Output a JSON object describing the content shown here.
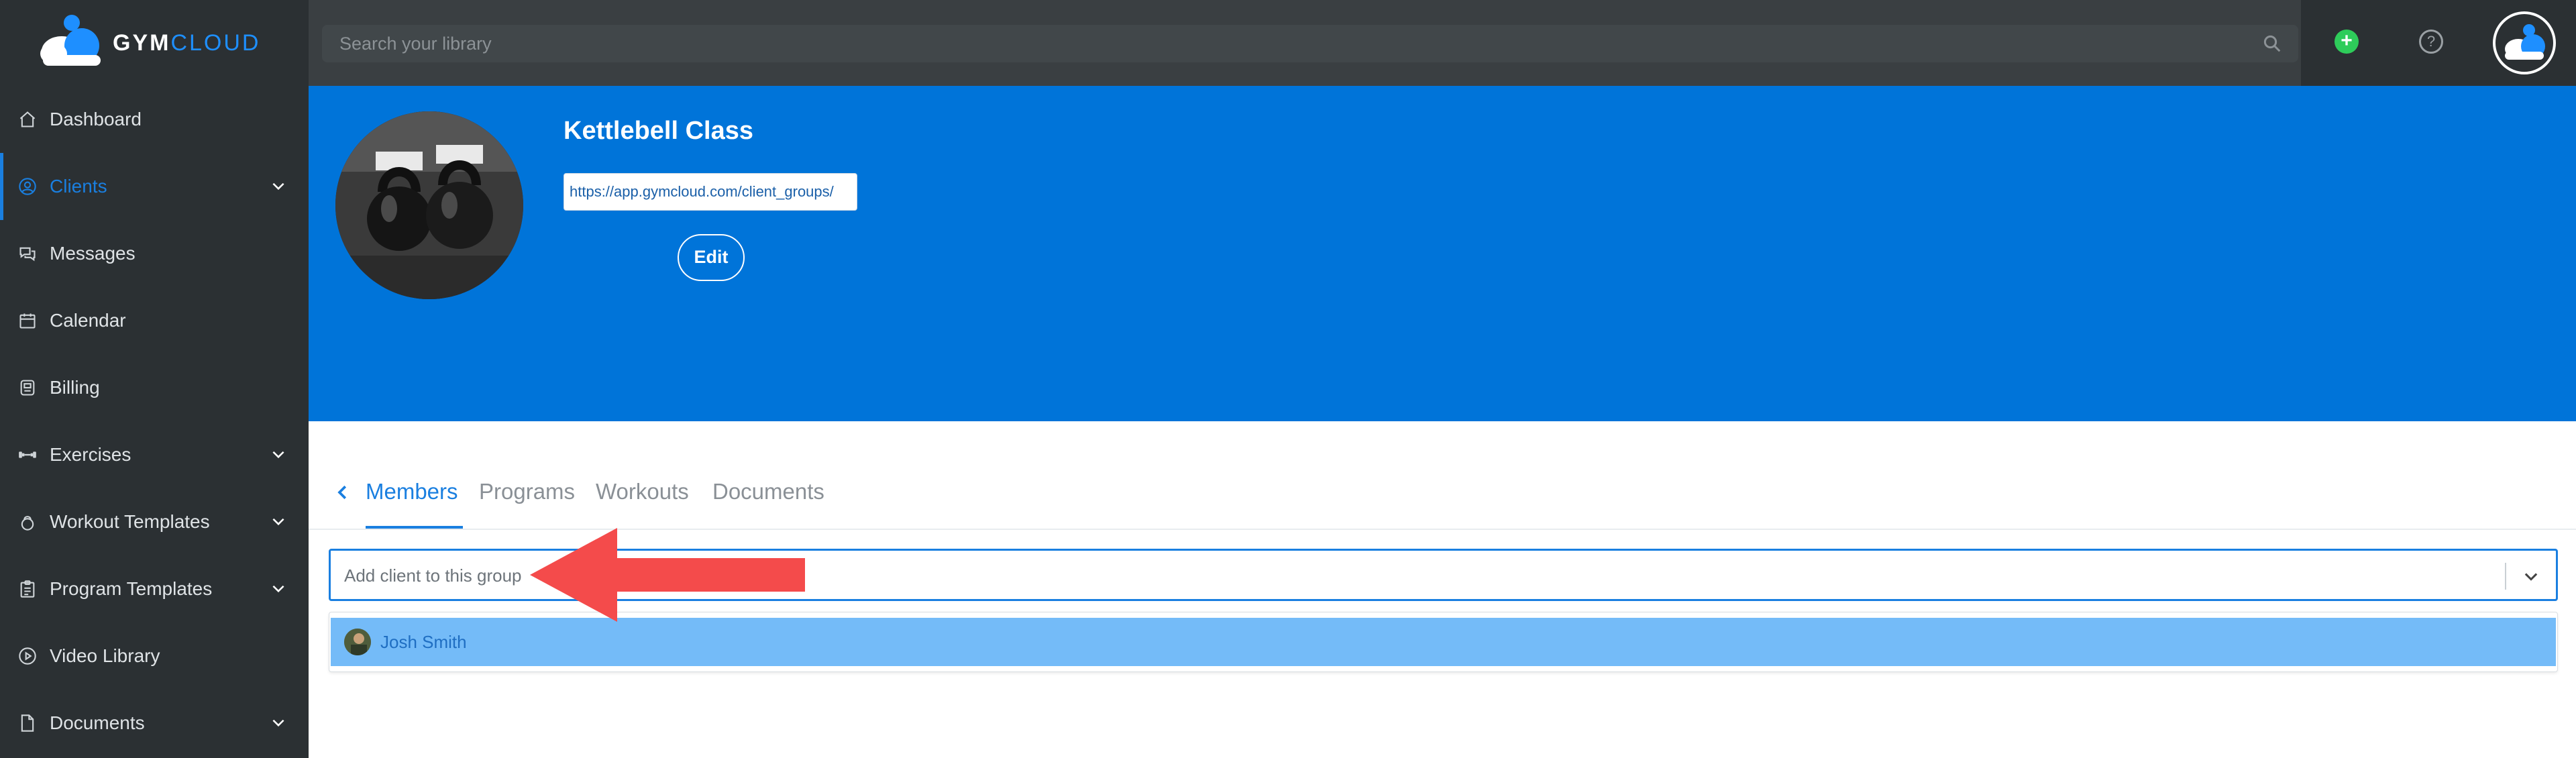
{
  "brand": {
    "name_white": "GYM",
    "name_blue": "CLOUD"
  },
  "search": {
    "placeholder": "Search your library"
  },
  "sidebar": {
    "items": [
      {
        "label": "Dashboard",
        "icon": "home-icon",
        "has_chevron": false,
        "active": false
      },
      {
        "label": "Clients",
        "icon": "user-circle-icon",
        "has_chevron": true,
        "active": true
      },
      {
        "label": "Messages",
        "icon": "chat-icon",
        "has_chevron": false,
        "active": false
      },
      {
        "label": "Calendar",
        "icon": "calendar-icon",
        "has_chevron": false,
        "active": false
      },
      {
        "label": "Billing",
        "icon": "billing-icon",
        "has_chevron": false,
        "active": false
      },
      {
        "label": "Exercises",
        "icon": "dumbbell-icon",
        "has_chevron": true,
        "active": false
      },
      {
        "label": "Workout Templates",
        "icon": "kettlebell-icon",
        "has_chevron": true,
        "active": false
      },
      {
        "label": "Program Templates",
        "icon": "clipboard-icon",
        "has_chevron": true,
        "active": false
      },
      {
        "label": "Video Library",
        "icon": "play-circle-icon",
        "has_chevron": false,
        "active": false
      },
      {
        "label": "Documents",
        "icon": "document-icon",
        "has_chevron": true,
        "active": false
      }
    ]
  },
  "group": {
    "name": "Kettlebell Class",
    "url": "https://app.gymcloud.com/client_groups/",
    "edit_label": "Edit"
  },
  "tabs": [
    {
      "label": "Members",
      "active": true
    },
    {
      "label": "Programs",
      "active": false
    },
    {
      "label": "Workouts",
      "active": false
    },
    {
      "label": "Documents",
      "active": false
    }
  ],
  "add_client": {
    "placeholder": "Add client to this group",
    "options": [
      {
        "name": "Josh Smith"
      }
    ]
  },
  "colors": {
    "sidebar_bg": "#2b3033",
    "topbar_bg": "#3a3f42",
    "banner_blue": "#0074d9",
    "accent": "#1a7fe0",
    "highlight_option": "#74bbf8",
    "add_button": "#2ecc5a",
    "annotation_arrow": "#f44b4b"
  }
}
